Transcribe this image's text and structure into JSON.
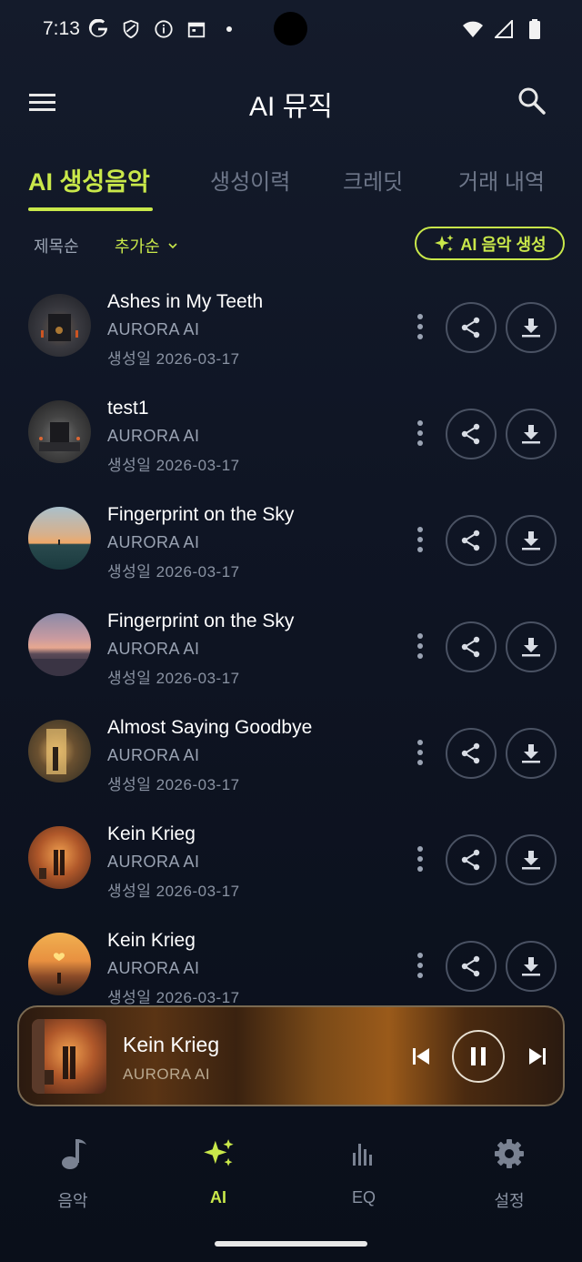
{
  "status_bar": {
    "time": "7:13",
    "icons_left": [
      "google-icon",
      "shield-icon",
      "info-icon",
      "calendar-icon",
      "dot-icon"
    ],
    "icons_right": [
      "wifi-icon",
      "signal-icon",
      "battery-icon"
    ]
  },
  "app_bar": {
    "title": "AI 뮤직",
    "menu_icon": "hamburger-menu-icon",
    "search_icon": "search-icon"
  },
  "tabs": [
    {
      "label": "AI 생성음악",
      "active": true
    },
    {
      "label": "생성이력",
      "active": false
    },
    {
      "label": "크레딧",
      "active": false
    },
    {
      "label": "거래 내역",
      "active": false
    }
  ],
  "sort": {
    "title_label": "제목순",
    "added_label": "추가순",
    "generate_button": "AI 음악 생성"
  },
  "tracks": [
    {
      "title": "Ashes in My Teeth",
      "artist": "AURORA AI",
      "date": "생성일 2026-03-17"
    },
    {
      "title": "test1",
      "artist": "AURORA AI",
      "date": "생성일 2026-03-17"
    },
    {
      "title": "Fingerprint on the Sky",
      "artist": "AURORA AI",
      "date": "생성일 2026-03-17"
    },
    {
      "title": "Fingerprint on the Sky",
      "artist": "AURORA AI",
      "date": "생성일 2026-03-17"
    },
    {
      "title": "Almost Saying Goodbye",
      "artist": "AURORA AI",
      "date": "생성일 2026-03-17"
    },
    {
      "title": "Kein Krieg",
      "artist": "AURORA AI",
      "date": "생성일 2026-03-17"
    },
    {
      "title": "Kein Krieg",
      "artist": "AURORA AI",
      "date": "생성일 2026-03-17"
    }
  ],
  "player": {
    "title": "Kein Krieg",
    "artist": "AURORA AI"
  },
  "bottom_nav": [
    {
      "label": "음악",
      "icon": "music-note-icon",
      "active": false
    },
    {
      "label": "AI",
      "icon": "sparkle-icon",
      "active": true
    },
    {
      "label": "EQ",
      "icon": "equalizer-icon",
      "active": false
    },
    {
      "label": "설정",
      "icon": "gear-icon",
      "active": false
    }
  ],
  "colors": {
    "accent": "#c9e84a",
    "background": "#0f1524"
  }
}
